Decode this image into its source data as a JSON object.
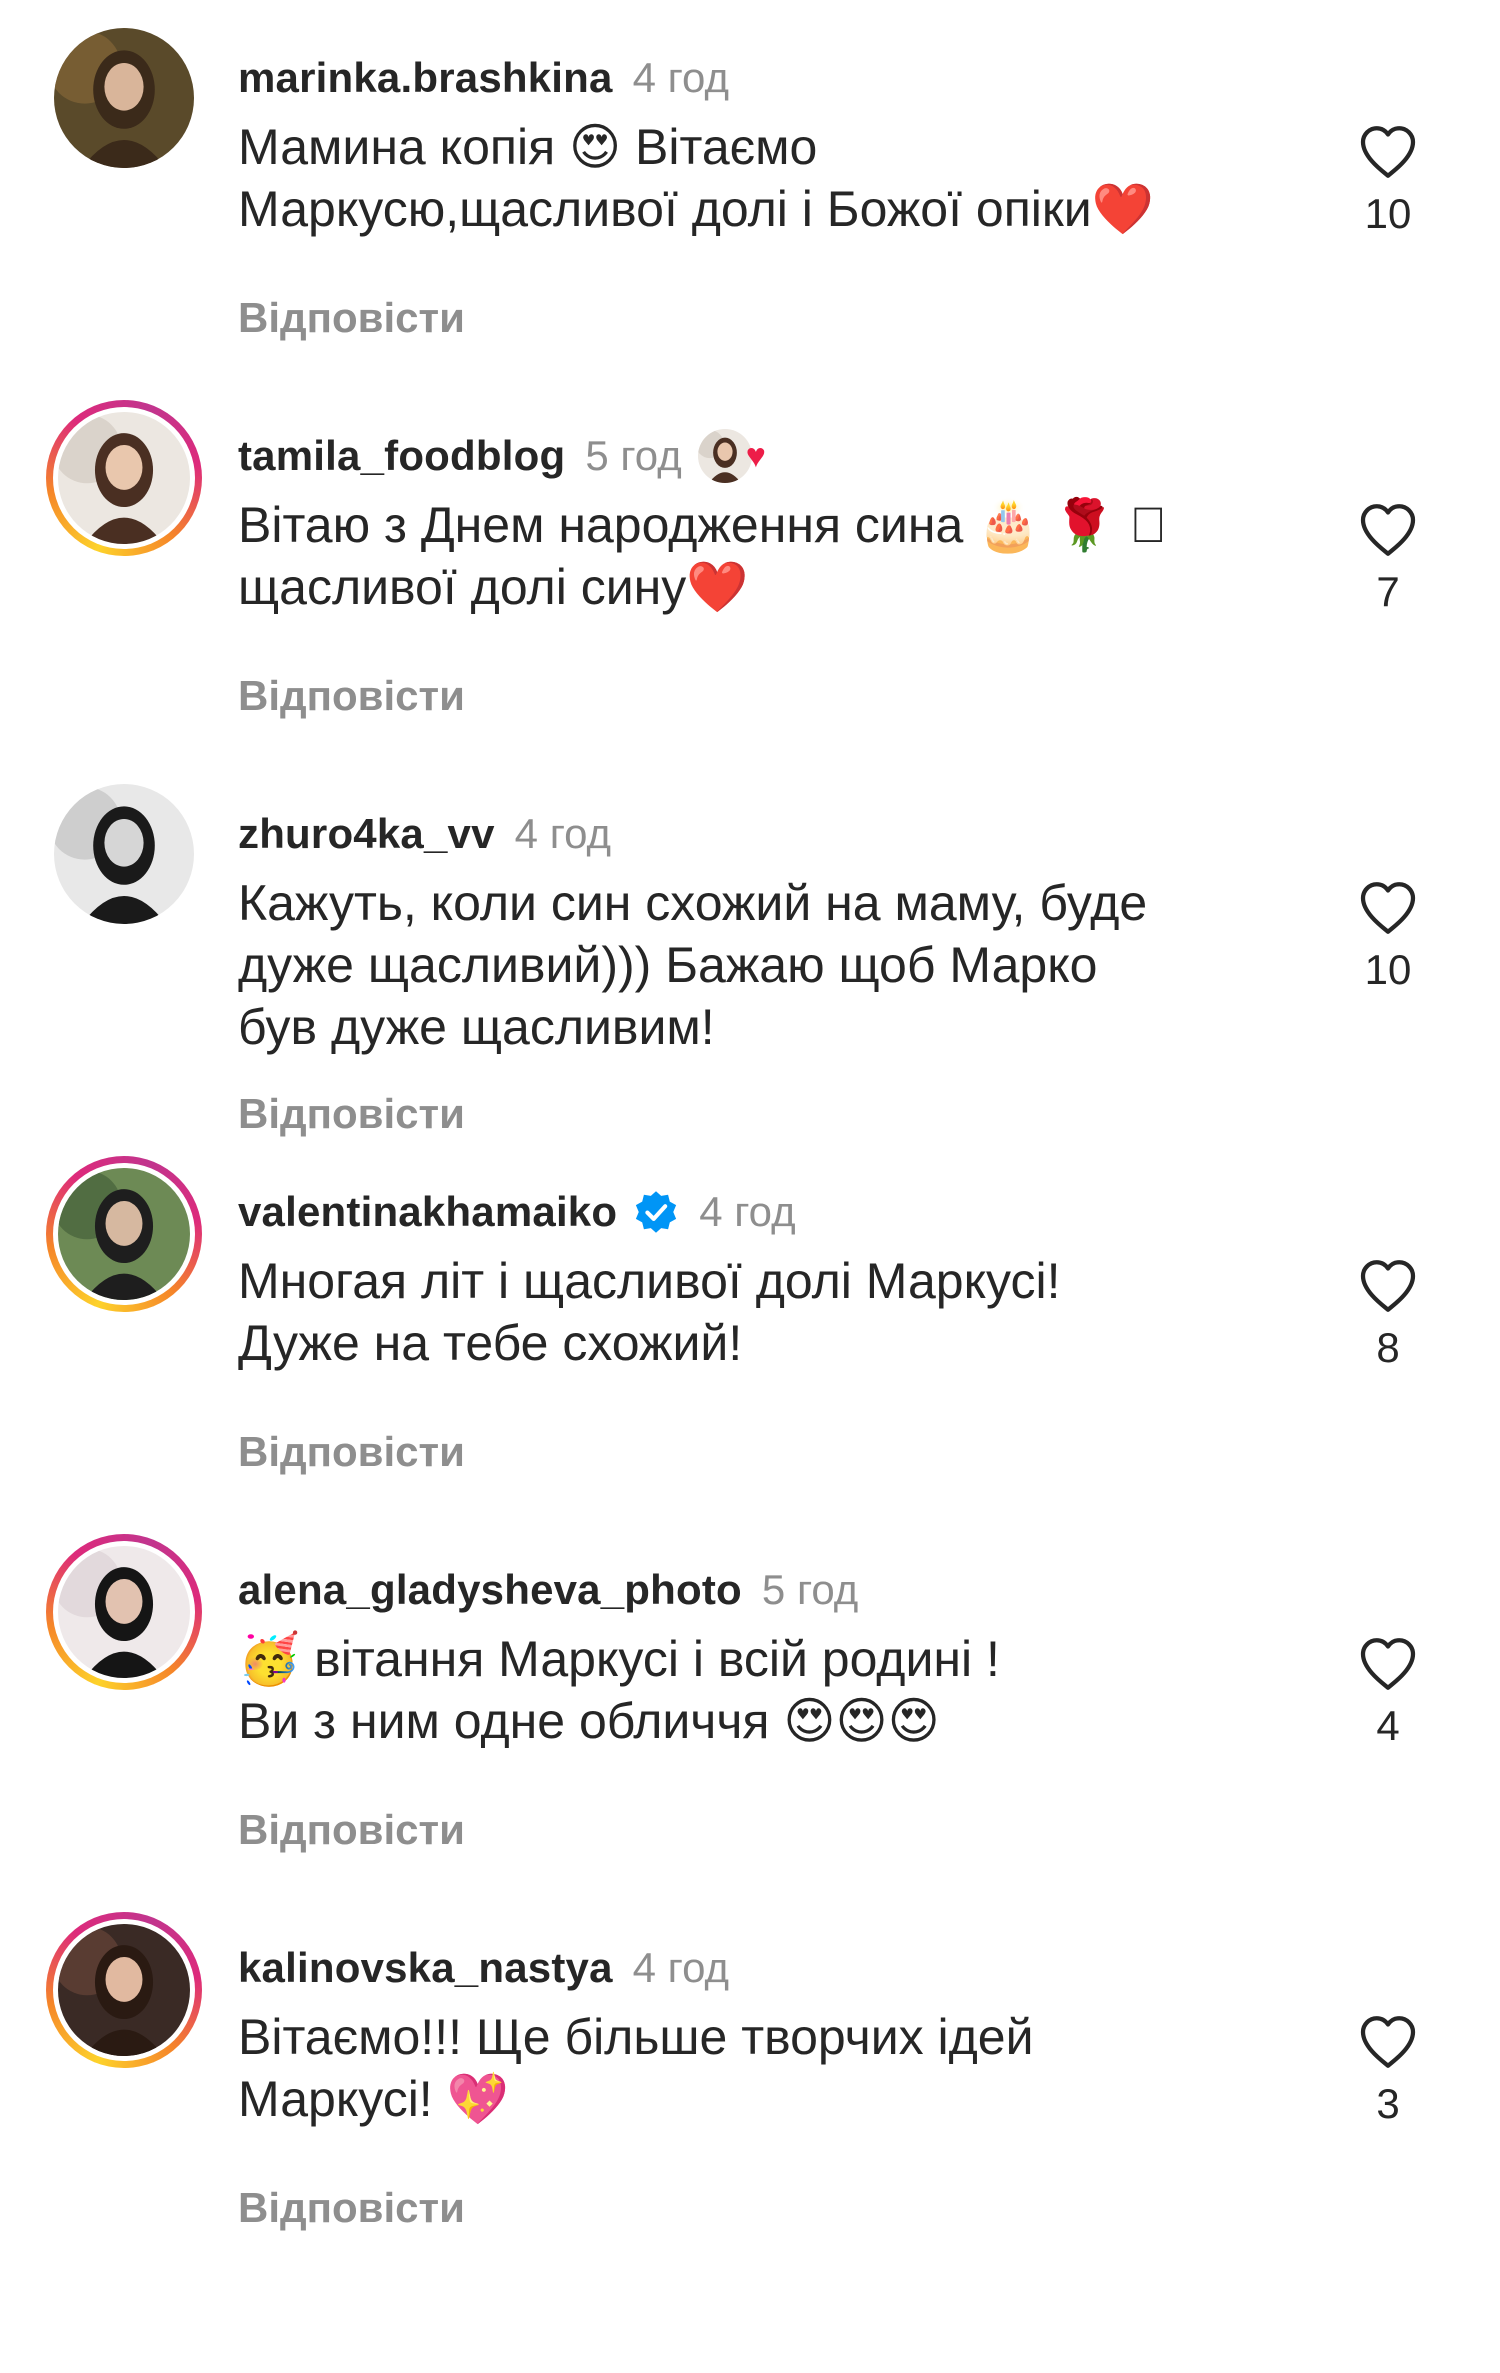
{
  "reply_label": "Відповісти",
  "colors": {
    "username": "#262626",
    "meta": "#8e8e8e",
    "verified": "#0095f6",
    "heart_emoji": "#e0182d",
    "story_ring": [
      "#fdd22b",
      "#f58529",
      "#dd2a7b",
      "#c1358e"
    ]
  },
  "comments": [
    {
      "username": "marinka.brashkina",
      "time": "4 год",
      "has_story": false,
      "verified": false,
      "author_liked": false,
      "text_lines": [
        "Мамина копія 😍 Вітаємо",
        "Маркусю,щасливої долі і Божої опіки❤️"
      ],
      "likes": "10",
      "avatar_icon": "avatar-photo"
    },
    {
      "username": "tamila_foodblog",
      "time": "5 год",
      "has_story": true,
      "verified": false,
      "author_liked": true,
      "text_lines": [
        "Вітаю з Днем народження сина 🎂 🌹 ⃞",
        "щасливої долі сину❤️"
      ],
      "likes": "7",
      "avatar_icon": "avatar-photo"
    },
    {
      "username": "zhuro4ka_vv",
      "time": "4 год",
      "has_story": false,
      "verified": false,
      "author_liked": false,
      "text_lines": [
        "Кажуть, коли син схожий на маму, буде",
        "дуже щасливий))) Бажаю щоб Марко",
        "був дуже щасливим!"
      ],
      "likes": "10",
      "avatar_icon": "avatar-photo"
    },
    {
      "username": "valentinakhamaiko",
      "time": "4 год",
      "has_story": true,
      "verified": true,
      "author_liked": false,
      "text_lines": [
        "Многая літ і щасливої долі Маркусі!",
        "Дуже на тебе схожий!"
      ],
      "likes": "8",
      "avatar_icon": "avatar-photo"
    },
    {
      "username": "alena_gladysheva_photo",
      "time": "5 год",
      "has_story": true,
      "verified": false,
      "author_liked": false,
      "text_lines": [
        "🥳 вітання Маркусі і всій родині !",
        "Ви з ним одне обличчя 😍😍😍"
      ],
      "likes": "4",
      "avatar_icon": "avatar-photo"
    },
    {
      "username": "kalinovska_nastya",
      "time": "4 год",
      "has_story": true,
      "verified": false,
      "author_liked": false,
      "text_lines": [
        "Вітаємо!!! Ще більше творчих ідей",
        "Маркусі! 💖"
      ],
      "likes": "3",
      "avatar_icon": "avatar-photo"
    }
  ]
}
